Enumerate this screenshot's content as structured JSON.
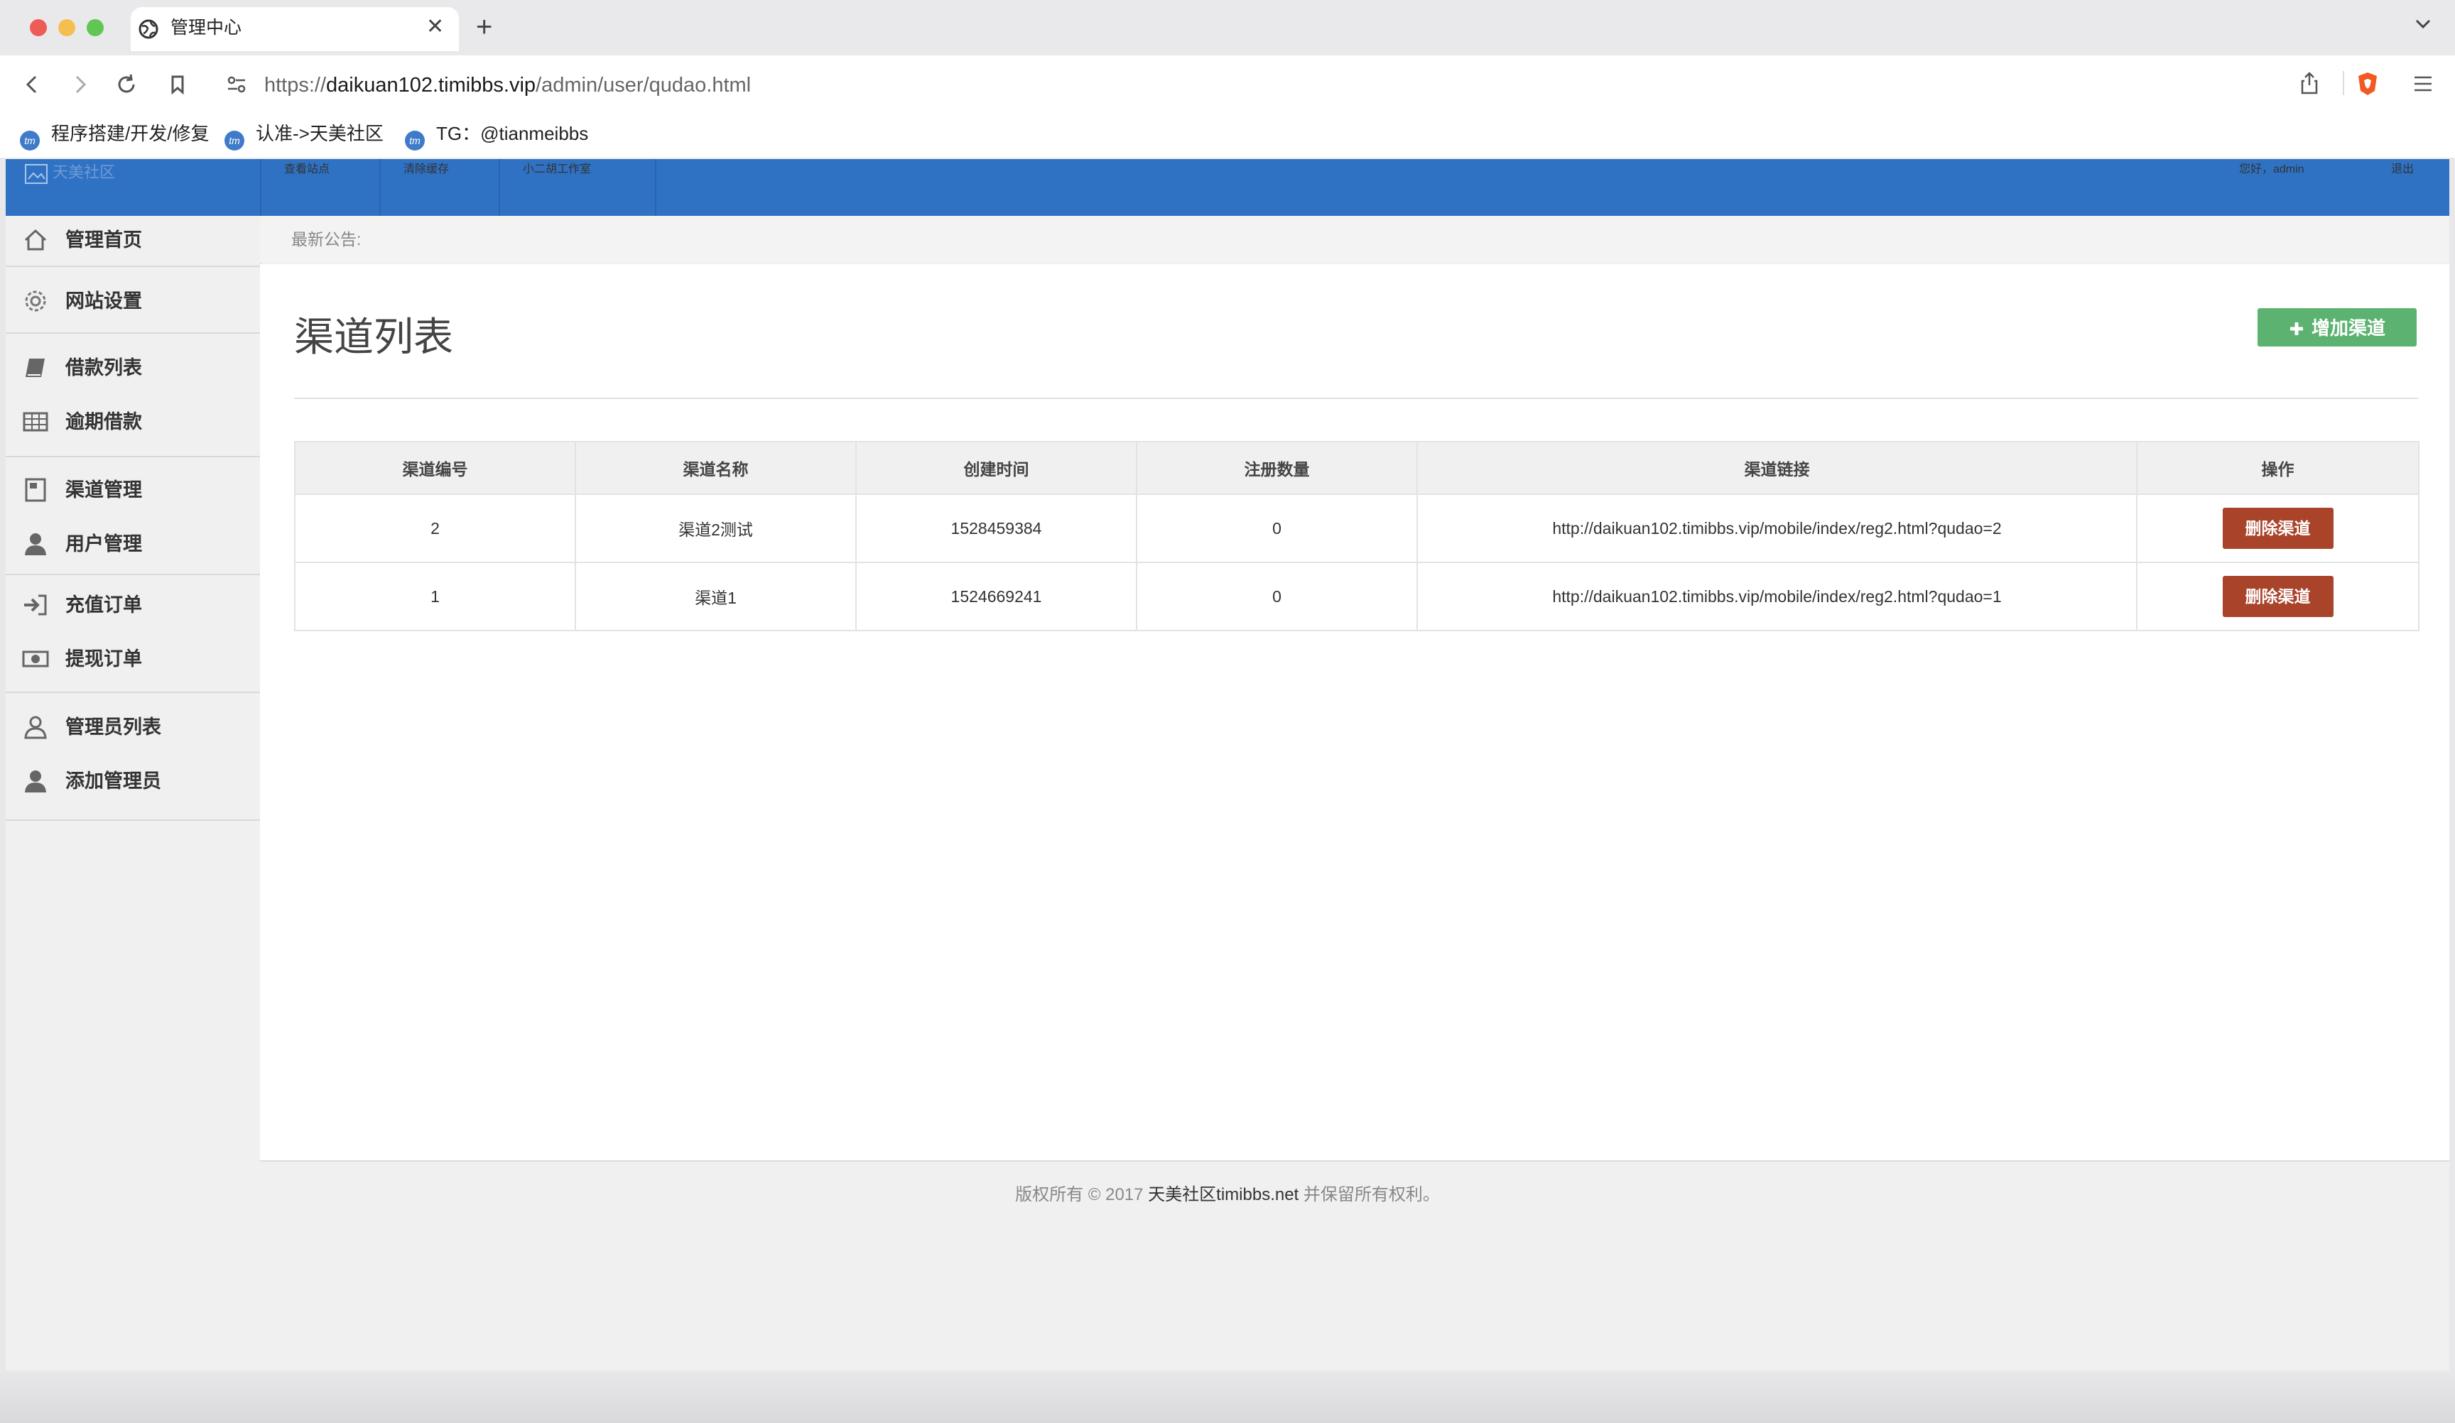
{
  "browser": {
    "tab_title": "管理中心",
    "tab_close": "✕",
    "new_tab": "+",
    "url_scheme": "https://",
    "url_host": "daikuan102.timibbs.vip",
    "url_path": "/admin/user/qudao.html",
    "bookmarks": [
      "程序搭建/开发/修复",
      "认准->天美社区",
      "TG：@tianmeibbs"
    ],
    "traffic_colors": [
      "#ee5c56",
      "#f6be4f",
      "#62c655"
    ]
  },
  "topnav": {
    "logo_alt": "天美社区",
    "links": [
      "查看站点",
      "清除缓存",
      "小二胡工作室"
    ],
    "greeting": "您好，admin",
    "logout": "退出",
    "color": "#2f72c4"
  },
  "sidebar": {
    "items": [
      {
        "label": "管理首页",
        "icon": "home-icon"
      },
      {
        "label": "网站设置",
        "icon": "gear-icon"
      },
      {
        "label": "借款列表",
        "icon": "book-icon"
      },
      {
        "label": "逾期借款",
        "icon": "table-icon"
      },
      {
        "label": "渠道管理",
        "icon": "document-icon"
      },
      {
        "label": "用户管理",
        "icon": "user-icon"
      },
      {
        "label": "充值订单",
        "icon": "sign-in-icon"
      },
      {
        "label": "提现订单",
        "icon": "money-icon"
      },
      {
        "label": "管理员列表",
        "icon": "user-outline-icon"
      },
      {
        "label": "添加管理员",
        "icon": "user-icon"
      }
    ]
  },
  "notice": {
    "label": "最新公告:"
  },
  "main": {
    "title": "渠道列表",
    "add_button": "增加渠道",
    "table": {
      "headers": [
        "渠道编号",
        "渠道名称",
        "创建时间",
        "注册数量",
        "渠道链接",
        "操作"
      ],
      "rows": [
        {
          "id": "2",
          "name": "渠道2测试",
          "created": "1528459384",
          "count": "0",
          "link": "http://daikuan102.timibbs.vip/mobile/index/reg2.html?qudao=2",
          "action": "删除渠道"
        },
        {
          "id": "1",
          "name": "渠道1",
          "created": "1524669241",
          "count": "0",
          "link": "http://daikuan102.timibbs.vip/mobile/index/reg2.html?qudao=1",
          "action": "删除渠道"
        }
      ]
    }
  },
  "footer": {
    "prefix": "版权所有 © 2017 ",
    "highlight": "天美社区timibbs.net",
    "suffix": " 并保留所有权利。"
  }
}
